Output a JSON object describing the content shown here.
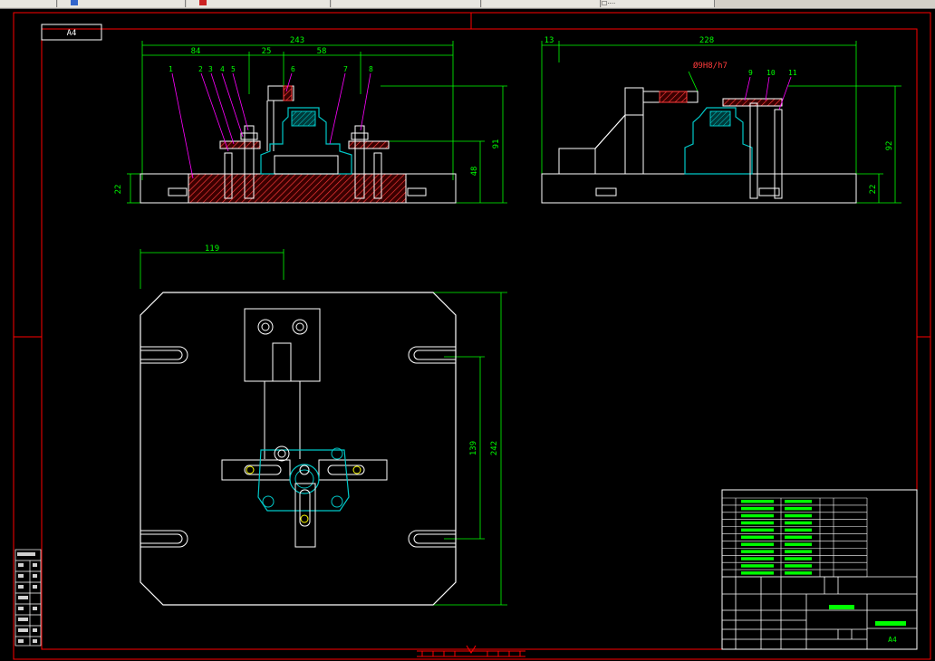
{
  "taskbar": {
    "tabs": [
      "",
      "",
      "",
      "",
      "",
      "",
      ""
    ],
    "tray_text": "☐····"
  },
  "sheet": {
    "size_label": "A4"
  },
  "front_view": {
    "dims": {
      "overall": "243",
      "left": "84",
      "mid": "25",
      "right": "58",
      "height_total": "91",
      "height_mid": "48",
      "base": "22"
    },
    "callouts": [
      "1",
      "2",
      "3",
      "4",
      "5",
      "6",
      "7",
      "8"
    ]
  },
  "side_view": {
    "dims": {
      "offset": "13",
      "overall": "228",
      "height_total": "92",
      "base": "22",
      "fit": "Ø9H8/h7"
    },
    "callouts": [
      "9",
      "10",
      "11"
    ]
  },
  "top_view": {
    "dims": {
      "offset": "119",
      "slot_span": "139",
      "overall": "242"
    }
  },
  "title_block": {
    "parts_rows": 11,
    "size_label": "A4"
  },
  "colors": {
    "background": "#000000",
    "frame": "#ff0000",
    "outline": "#ffffff",
    "dimension": "#00ff00",
    "leader": "#ff00ff",
    "section": "#ff3b3b",
    "fixture": "#00c8c8",
    "highlight": "#ffff00"
  }
}
